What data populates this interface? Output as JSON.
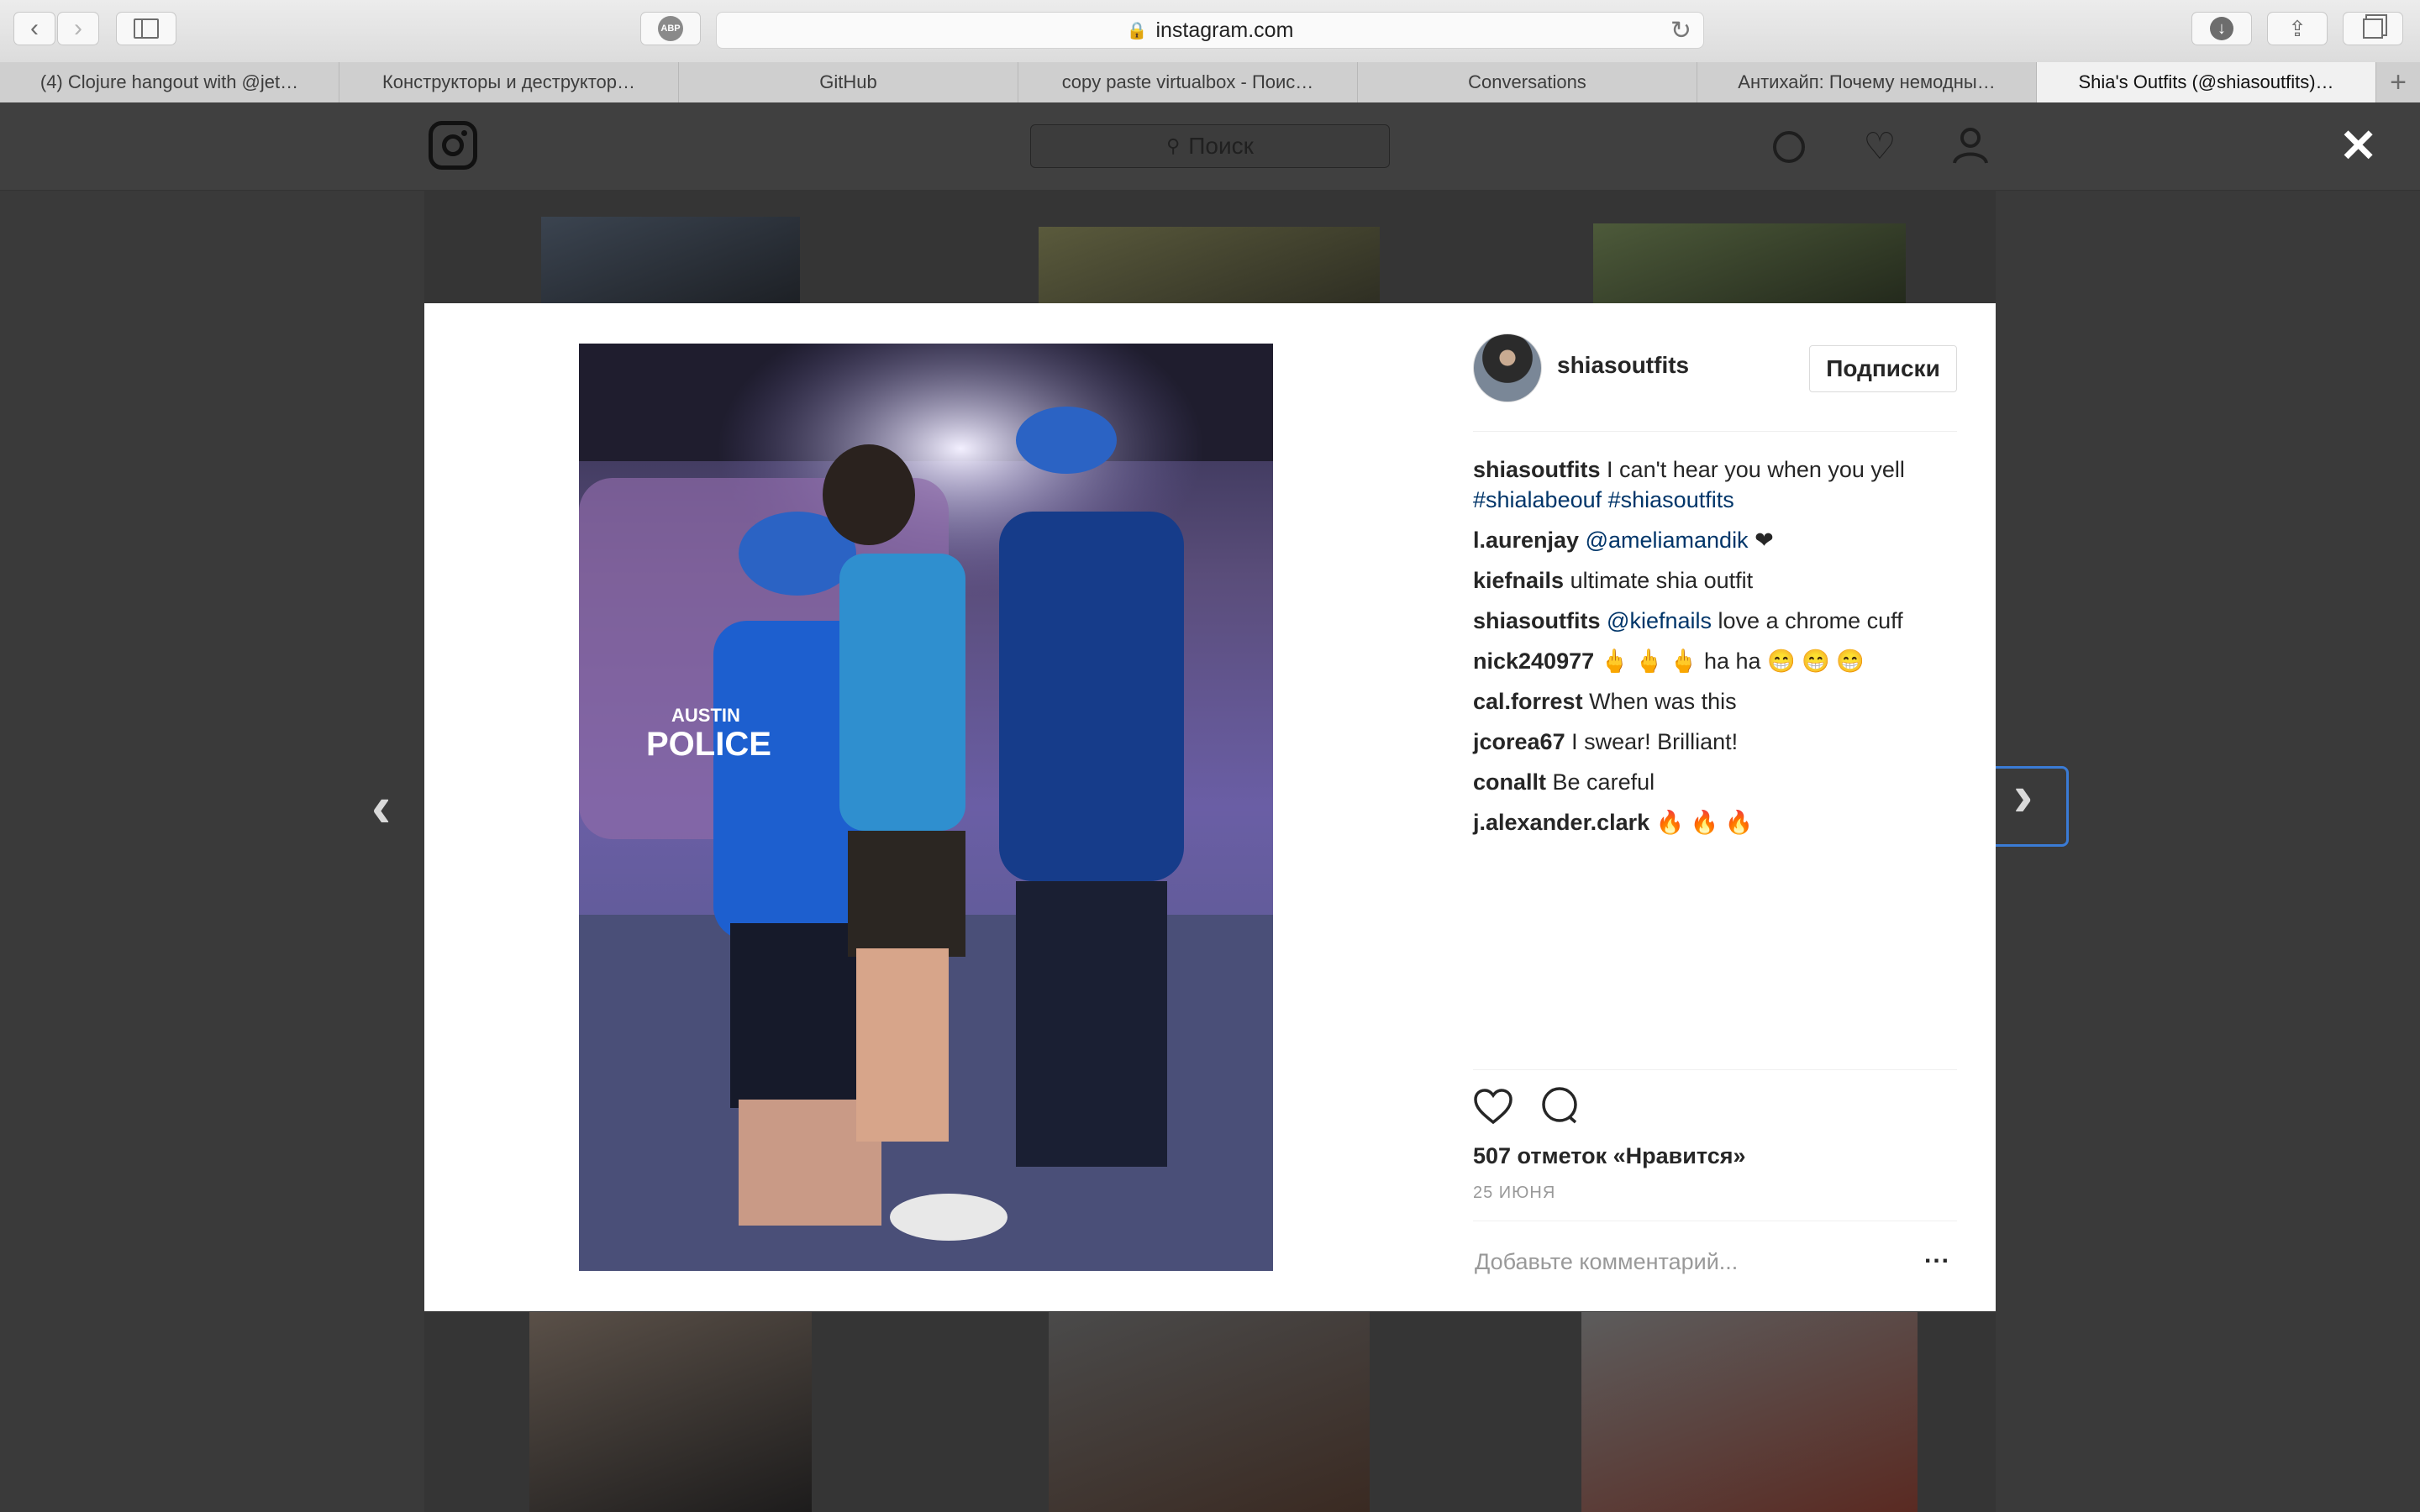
{
  "browser": {
    "address": "instagram.com",
    "tabs": [
      {
        "label": "(4) Clojure hangout with @jet…",
        "active": false
      },
      {
        "label": "Конструкторы и деструктор…",
        "active": false
      },
      {
        "label": "GitHub",
        "active": false
      },
      {
        "label": "copy paste virtualbox - Поис…",
        "active": false
      },
      {
        "label": "Conversations",
        "active": false
      },
      {
        "label": "Антихайп: Почему немодны…",
        "active": false
      },
      {
        "label": "Shia's Outfits (@shiasoutfits)…",
        "active": true
      }
    ],
    "abp_label": "ABP"
  },
  "instagram": {
    "search_placeholder": "Поиск"
  },
  "post": {
    "username": "shiasoutfits",
    "follow_label": "Подписки",
    "photo_labels": {
      "badge_line1": "AUSTIN",
      "badge_line2": "POLICE"
    },
    "comments": [
      {
        "user": "shiasoutfits",
        "text": "I can't hear you when you yell",
        "links": "#shialabeouf #shiasoutfits"
      },
      {
        "user": "l.aurenjay",
        "link": "@ameliamandik",
        "text": "❤"
      },
      {
        "user": "kiefnails",
        "text": "ultimate shia outfit"
      },
      {
        "user": "shiasoutfits",
        "link": "@kiefnails",
        "text": "love a chrome cuff"
      },
      {
        "user": "nick240977",
        "text": "🖕 🖕 🖕 ha ha 😁 😁 😁"
      },
      {
        "user": "cal.forrest",
        "text": "When was this"
      },
      {
        "user": "jcorea67",
        "text": "I swear! Brilliant!"
      },
      {
        "user": "conallt",
        "text": "Be careful"
      },
      {
        "user": "j.alexander.clark",
        "text": "🔥 🔥 🔥"
      }
    ],
    "likes": "507 отметок «Нравится»",
    "date": "25 ИЮНЯ",
    "comment_placeholder": "Добавьте комментарий...",
    "more_label": "..."
  },
  "colors": {
    "link": "#003569",
    "overlay": "#3a3a3a",
    "accent_outline": "#3a7bd5"
  }
}
